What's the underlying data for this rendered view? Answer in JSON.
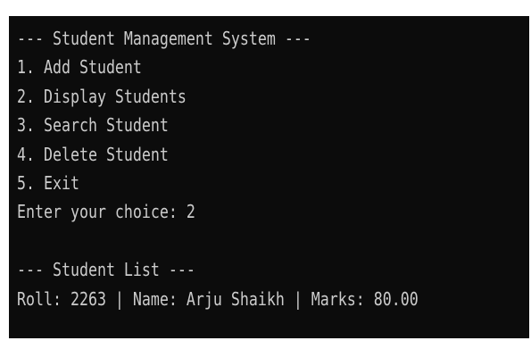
{
  "terminal": {
    "lines": [
      "--- Student Management System ---",
      "1. Add Student",
      "2. Display Students",
      "3. Search Student",
      "4. Delete Student",
      "5. Exit",
      "Enter your choice: 2",
      "",
      "--- Student List ---",
      "Roll: 2263 | Name: Arju Shaikh | Marks: 80.00"
    ]
  },
  "colors": {
    "background": "#0c0c0c",
    "text": "#cccccc",
    "page": "#ffffff"
  }
}
